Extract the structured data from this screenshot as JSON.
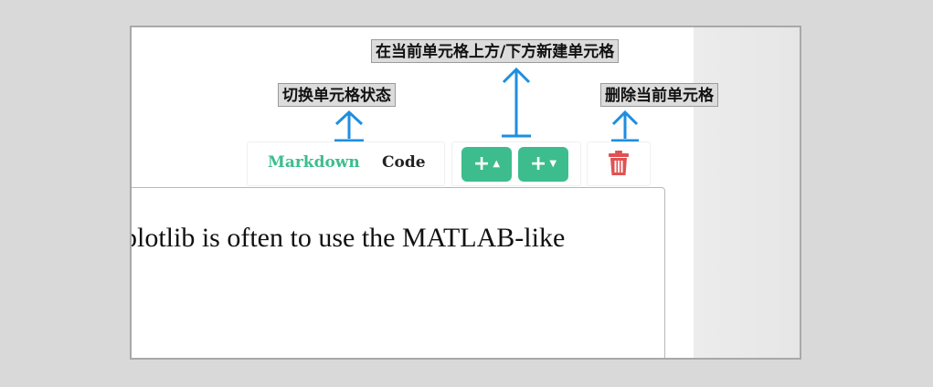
{
  "callouts": {
    "toggle_label": "切换单元格状态",
    "insert_label": "在当前单元格上方/下方新建单元格",
    "delete_label": "删除当前单元格"
  },
  "toolbar": {
    "markdown_label": "Markdown",
    "code_label": "Code",
    "add_above_icon": "plus-caret-up-icon",
    "add_below_icon": "plus-caret-down-icon",
    "delete_icon": "trash-icon"
  },
  "editor": {
    "text": "plotlib is often to use the MATLAB-like"
  },
  "colors": {
    "accent_green": "#3dbd8d",
    "arrow_blue": "#1e8ee0",
    "delete_red": "#e05252"
  }
}
